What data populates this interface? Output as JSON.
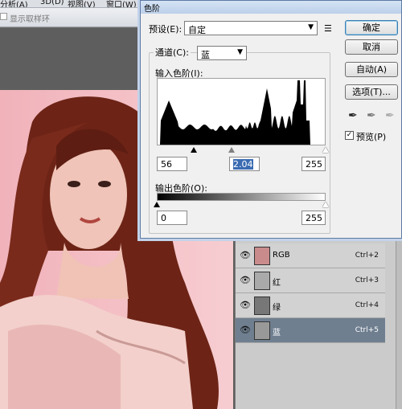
{
  "menubar": {
    "items": [
      "分析(A)",
      "3D(D)",
      "视图(V)",
      "窗口(W)"
    ]
  },
  "optbar": {
    "show_transform_label": "显示取样环"
  },
  "layers": {
    "rows": [
      {
        "name": "RGB",
        "shortcut": "Ctrl+2"
      },
      {
        "name": "红",
        "shortcut": "Ctrl+3"
      },
      {
        "name": "绿",
        "shortcut": "Ctrl+4"
      },
      {
        "name": "蓝",
        "shortcut": "Ctrl+5"
      }
    ]
  },
  "dialog": {
    "title": "色阶",
    "preset_label": "预设(E):",
    "preset_value": "自定",
    "channel_label": "通道(C):",
    "channel_value": "蓝",
    "input_levels_label": "输入色阶(I):",
    "input_black": "56",
    "input_gamma": "2.04",
    "input_white": "255",
    "output_levels_label": "输出色阶(O):",
    "output_black": "0",
    "output_white": "255",
    "buttons": {
      "ok": "确定",
      "cancel": "取消",
      "auto": "自动(A)",
      "options": "选项(T)..."
    },
    "preview_label": "预览(P)",
    "preview_checked": true
  },
  "histogram": {
    "levels_range": [
      0,
      255
    ],
    "black_point": 56,
    "gamma": 2.04,
    "white_point": 255
  }
}
